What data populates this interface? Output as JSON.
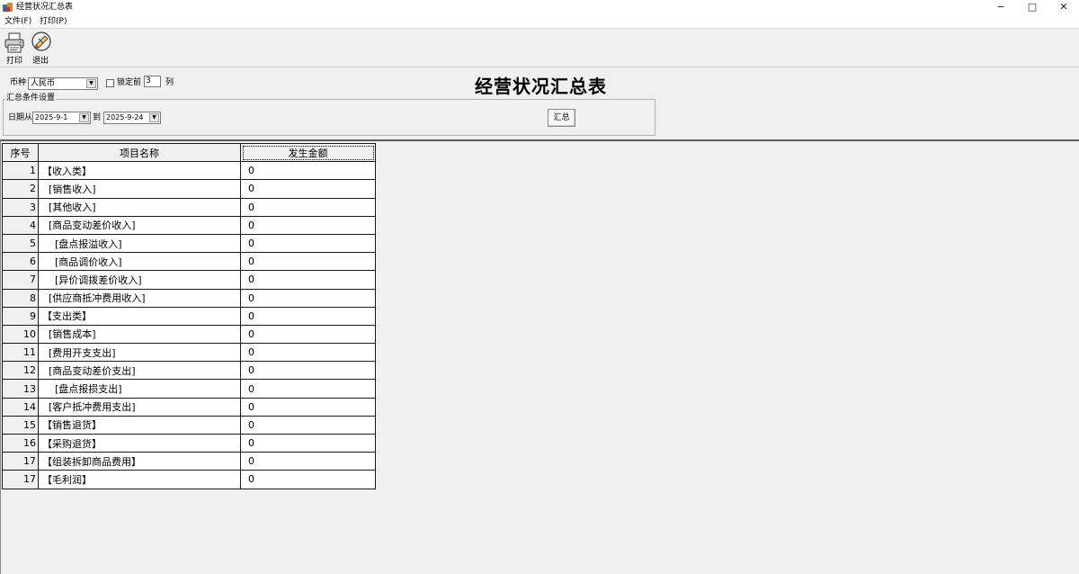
{
  "window": {
    "title": "经营状况汇总表",
    "minimize": "−",
    "maximize": "□",
    "close": "✕"
  },
  "menu": {
    "file": "文件(F)",
    "print": "打印(P)"
  },
  "toolbar": {
    "print": {
      "label": "打印",
      "icon": "printer-icon"
    },
    "exit": {
      "label": "退出",
      "icon": "exit-icon"
    }
  },
  "controls": {
    "currency_label": "币种",
    "currency_value": "人民币",
    "lock_label": "锁定前",
    "lock_value": "3",
    "col_label": "列",
    "lock_checked": false
  },
  "report_title": "经营状况汇总表",
  "summary_group": {
    "legend": "汇总条件设置",
    "date_from_label": "日期从",
    "date_from": "2025-9-1",
    "date_to_label": "到",
    "date_to": "2025-9-24",
    "summary_button": "汇总"
  },
  "grid": {
    "headers": [
      "序号",
      "项目名称",
      "发生金额"
    ],
    "rows": [
      {
        "seq": "1",
        "name": "【收入类】",
        "amount": "0"
      },
      {
        "seq": "2",
        "name": "  [销售收入]",
        "amount": "0"
      },
      {
        "seq": "3",
        "name": "  [其他收入]",
        "amount": "0"
      },
      {
        "seq": "4",
        "name": "  [商品变动差价收入]",
        "amount": "0"
      },
      {
        "seq": "5",
        "name": "    [盘点报溢收入]",
        "amount": "0"
      },
      {
        "seq": "6",
        "name": "    [商品调价收入]",
        "amount": "0"
      },
      {
        "seq": "7",
        "name": "    [异价调拨差价收入]",
        "amount": "0"
      },
      {
        "seq": "8",
        "name": "  [供应商抵冲费用收入]",
        "amount": "0"
      },
      {
        "seq": "9",
        "name": "【支出类】",
        "amount": "0"
      },
      {
        "seq": "10",
        "name": "  [销售成本]",
        "amount": "0"
      },
      {
        "seq": "11",
        "name": "  [费用开支支出]",
        "amount": "0"
      },
      {
        "seq": "12",
        "name": "  [商品变动差价支出]",
        "amount": "0"
      },
      {
        "seq": "13",
        "name": "    [盘点报损支出]",
        "amount": "0"
      },
      {
        "seq": "14",
        "name": "  [客户抵冲费用支出]",
        "amount": "0"
      },
      {
        "seq": "15",
        "name": "【销售退货】",
        "amount": "0"
      },
      {
        "seq": "16",
        "name": "【采购退货】",
        "amount": "0"
      },
      {
        "seq": "17",
        "name": "【组装拆卸商品费用】",
        "amount": "0"
      },
      {
        "seq": "17",
        "name": "【毛利润】",
        "amount": "0"
      }
    ]
  }
}
